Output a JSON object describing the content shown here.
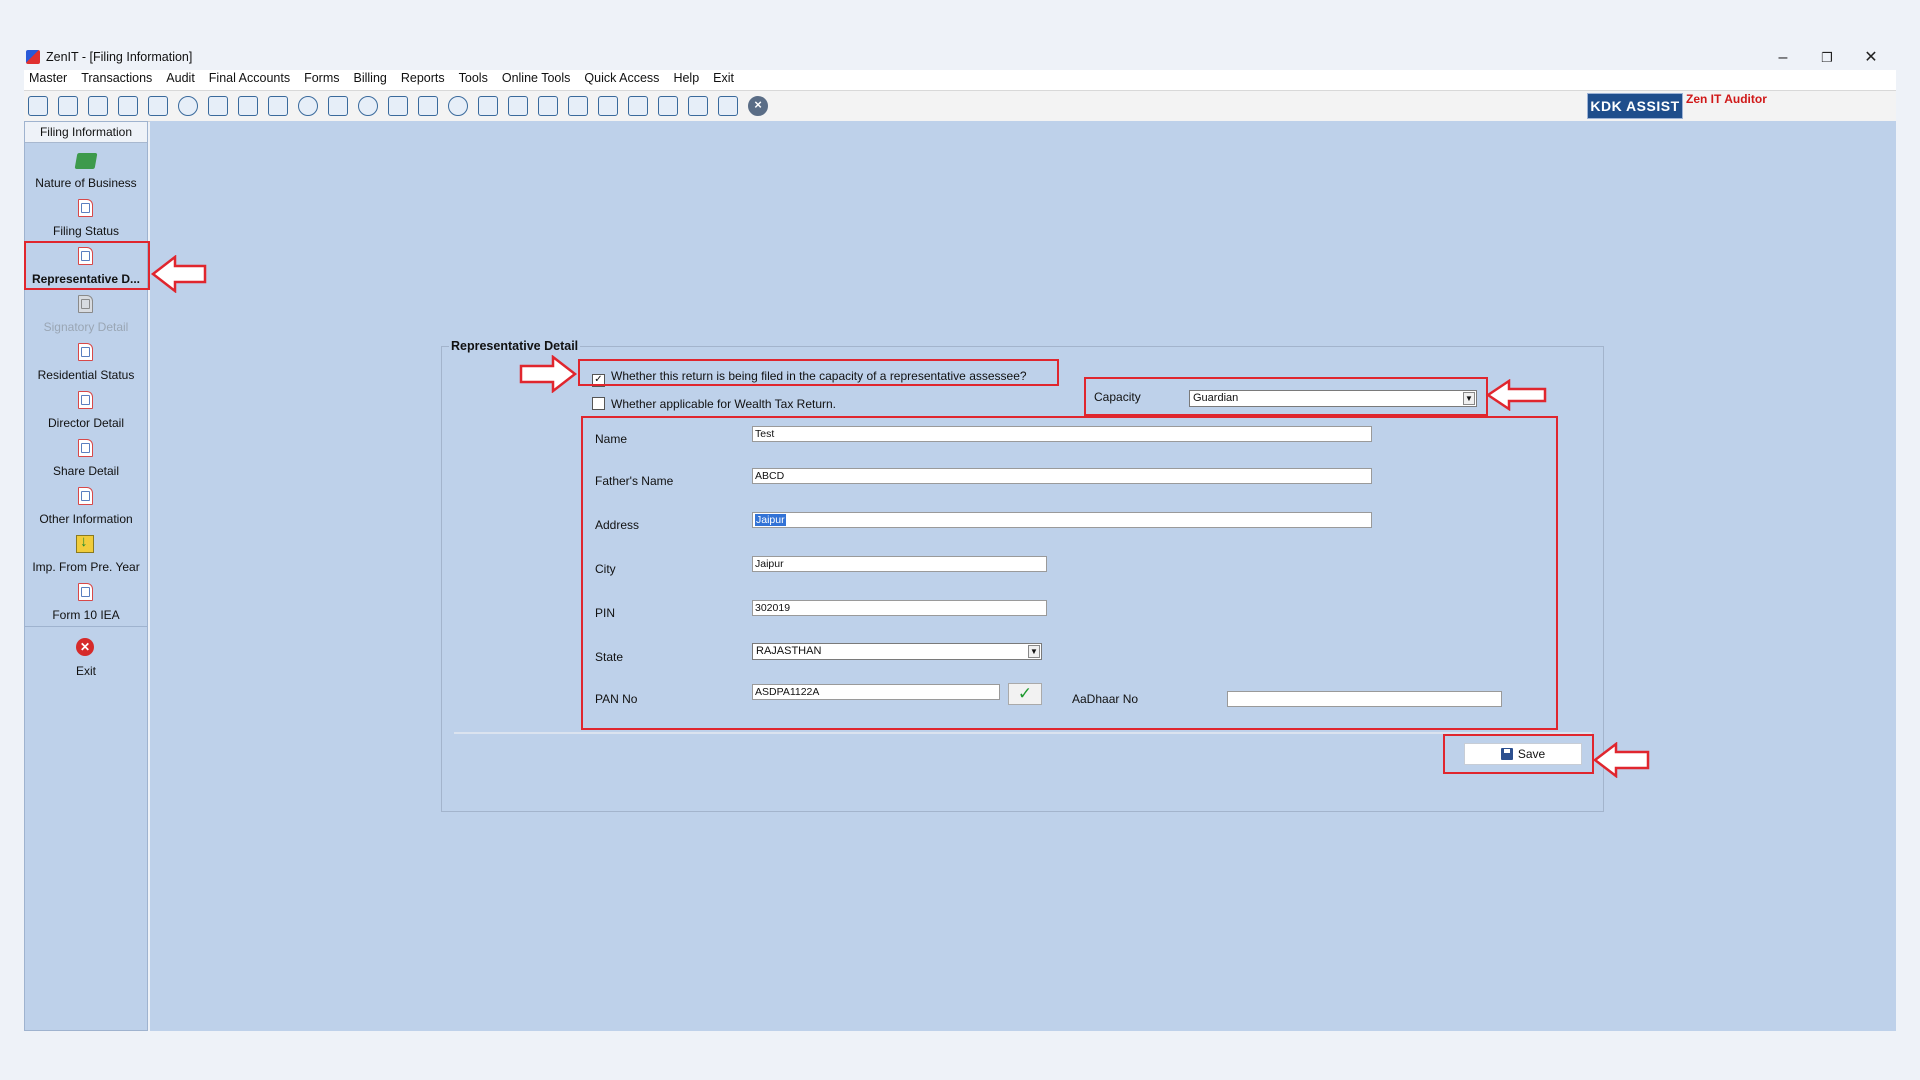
{
  "window": {
    "title": "ZenIT - [Filing Information]",
    "minimize": "–",
    "restore": "❐",
    "close": "✕"
  },
  "menu": [
    "Master",
    "Transactions",
    "Audit",
    "Final Accounts",
    "Forms",
    "Billing",
    "Reports",
    "Tools",
    "Online Tools",
    "Quick Access",
    "Help",
    "Exit"
  ],
  "toolbar": {
    "brand_button": "KDK ASSIST",
    "brand_text": "Zen IT Auditor",
    "close_glyph": "×"
  },
  "sidebar": {
    "header": "Filing Information",
    "items": [
      {
        "label": "Nature of Business",
        "icon": "money-icon"
      },
      {
        "label": "Filing Status",
        "icon": "document-icon"
      },
      {
        "label": "Representative D...",
        "icon": "document-icon",
        "active": true
      },
      {
        "label": "Signatory Detail",
        "icon": "document-icon",
        "disabled": true
      },
      {
        "label": "Residential Status",
        "icon": "document-icon"
      },
      {
        "label": "Director Detail",
        "icon": "document-icon"
      },
      {
        "label": "Share Detail",
        "icon": "document-icon"
      },
      {
        "label": "Other Information",
        "icon": "document-icon"
      },
      {
        "label": "Imp. From Pre. Year",
        "icon": "import-icon"
      },
      {
        "label": "Form 10 IEA",
        "icon": "document-icon"
      }
    ],
    "exit_label": "Exit",
    "exit_glyph": "✕"
  },
  "form": {
    "title": "Representative Detail",
    "representative_checkbox": {
      "label": "Whether this return is being filed in the capacity of a representative assessee?",
      "checked": true,
      "glyph": "✓"
    },
    "wealth_tax_checkbox": {
      "label": "Whether applicable for Wealth Tax Return.",
      "checked": false
    },
    "capacity": {
      "label": "Capacity",
      "value": "Guardian",
      "arrow": "▼"
    },
    "name": {
      "label": "Name",
      "value": "Test"
    },
    "fathers_name": {
      "label": "Father's Name",
      "value": "ABCD"
    },
    "address": {
      "label": "Address",
      "value": "Jaipur"
    },
    "city": {
      "label": "City",
      "value": "Jaipur"
    },
    "pin": {
      "label": "PIN",
      "value": "302019"
    },
    "state": {
      "label": "State",
      "value": "RAJASTHAN",
      "arrow": "▼"
    },
    "pan": {
      "label": "PAN No",
      "value": "ASDPA1122A",
      "verify_glyph": "✓"
    },
    "aadhaar": {
      "label": "AaDhaar No",
      "value": ""
    },
    "save_label": "Save"
  },
  "colors": {
    "annotation": "#e0262e",
    "panel": "#bed1ea",
    "brand": "#1f4e8c"
  }
}
